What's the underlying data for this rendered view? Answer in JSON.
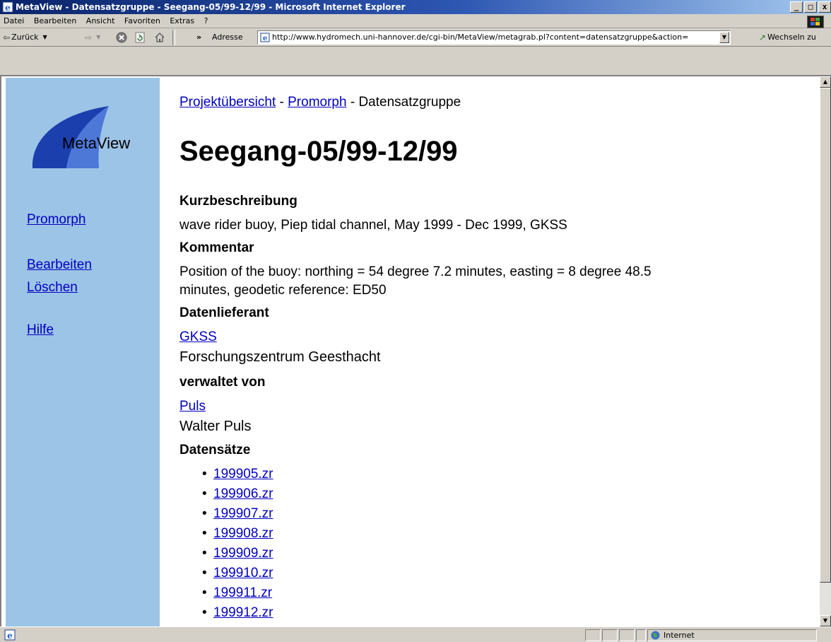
{
  "window": {
    "title": "MetaView - Datensatzgruppe - Seegang-05/99-12/99 - Microsoft Internet Explorer",
    "min_label": "_",
    "max_label": "□",
    "close_label": "x"
  },
  "menu": [
    "Datei",
    "Bearbeiten",
    "Ansicht",
    "Favoriten",
    "Extras",
    "?"
  ],
  "toolbar": {
    "back_label": "Zurück",
    "address_label": "Adresse",
    "url": "http://www.hydromech.uni-hannover.de/cgi-bin/MetaView/metagrab.pl?content=datensatzgruppe&action=",
    "go_label": "Wechseln zu",
    "chevron": "»"
  },
  "sidebar": {
    "logo_text": "MetaView",
    "links": [
      "Promorph",
      "Bearbeiten",
      "Löschen",
      "Hilfe"
    ]
  },
  "page": {
    "breadcrumb": {
      "item1": "Projektübersicht",
      "sep1": " - ",
      "item2": "Promorph",
      "sep2": " - ",
      "current": "Datensatzgruppe"
    },
    "title": "Seegang-05/99-12/99",
    "kurz_label": "Kurzbeschreibung",
    "kurz_text": "wave rider buoy, Piep tidal channel, May 1999 - Dec 1999, GKSS",
    "kommentar_label": "Kommentar",
    "kommentar_line1": "Position of the buoy: northing = 54 degree 7.2 minutes, easting = 8 degree 48.5",
    "kommentar_line2": "minutes, geodetic reference: ED50",
    "lieferant_label": "Datenlieferant",
    "lieferant_link": "GKSS",
    "lieferant_name": "Forschungszentrum Geesthacht",
    "verwaltet_label": "verwaltet von",
    "verwaltet_link": "Puls",
    "verwaltet_name": "Walter Puls",
    "datensaetze_label": "Datensätze",
    "datensaetze": [
      "199905.zr",
      "199906.zr",
      "199907.zr",
      "199908.zr",
      "199909.zr",
      "199910.zr",
      "199911.zr",
      "199912.zr"
    ]
  },
  "status": {
    "zone": "Internet"
  }
}
